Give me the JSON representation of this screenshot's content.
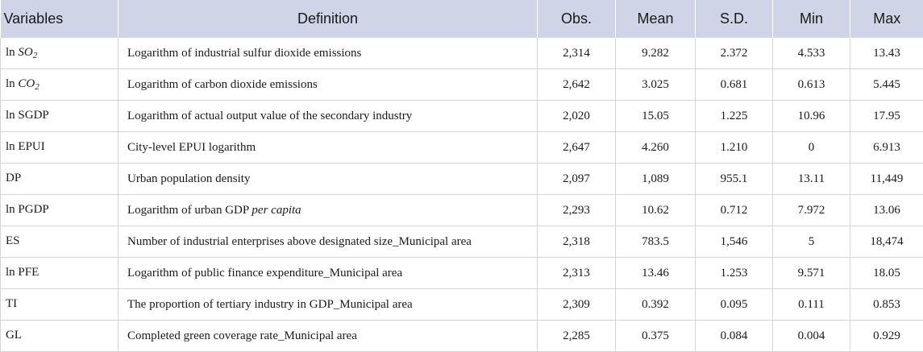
{
  "header": {
    "variables": "Variables",
    "definition": "Definition",
    "obs": "Obs.",
    "mean": "Mean",
    "sd": "S.D.",
    "min": "Min",
    "max": "Max"
  },
  "rows": [
    {
      "var_prefix": "ln ",
      "var_main": "SO",
      "var_sub": "2",
      "def_pre": "Logarithm of industrial sulfur dioxide emissions",
      "def_it": "",
      "obs": "2,314",
      "mean": "9.282",
      "sd": "2.372",
      "min": "4.533",
      "max": "13.43"
    },
    {
      "var_prefix": "ln ",
      "var_main": "CO",
      "var_sub": "2",
      "def_pre": "Logarithm of carbon dioxide emissions",
      "def_it": "",
      "obs": "2,642",
      "mean": "3.025",
      "sd": "0.681",
      "min": "0.613",
      "max": "5.445"
    },
    {
      "var_prefix": "ln SGDP",
      "var_main": "",
      "var_sub": "",
      "def_pre": "Logarithm of actual output value of the secondary industry",
      "def_it": "",
      "obs": "2,020",
      "mean": "15.05",
      "sd": "1.225",
      "min": "10.96",
      "max": "17.95"
    },
    {
      "var_prefix": "ln EPUI",
      "var_main": "",
      "var_sub": "",
      "def_pre": "City-level EPUI logarithm",
      "def_it": "",
      "obs": "2,647",
      "mean": "4.260",
      "sd": "1.210",
      "min": "0",
      "max": "6.913"
    },
    {
      "var_prefix": "DP",
      "var_main": "",
      "var_sub": "",
      "def_pre": "Urban population density",
      "def_it": "",
      "obs": "2,097",
      "mean": "1,089",
      "sd": "955.1",
      "min": "13.11",
      "max": "11,449"
    },
    {
      "var_prefix": "ln PGDP",
      "var_main": "",
      "var_sub": "",
      "def_pre": "Logarithm of urban GDP ",
      "def_it": "per capita",
      "obs": "2,293",
      "mean": "10.62",
      "sd": "0.712",
      "min": "7.972",
      "max": "13.06"
    },
    {
      "var_prefix": "ES",
      "var_main": "",
      "var_sub": "",
      "def_pre": "Number of industrial enterprises above designated size_Municipal area",
      "def_it": "",
      "obs": "2,318",
      "mean": "783.5",
      "sd": "1,546",
      "min": "5",
      "max": "18,474"
    },
    {
      "var_prefix": "ln PFE",
      "var_main": "",
      "var_sub": "",
      "def_pre": "Logarithm of public finance expenditure_Municipal area",
      "def_it": "",
      "obs": "2,313",
      "mean": "13.46",
      "sd": "1.253",
      "min": "9.571",
      "max": "18.05"
    },
    {
      "var_prefix": "TI",
      "var_main": "",
      "var_sub": "",
      "def_pre": "The proportion of tertiary industry in GDP_Municipal area",
      "def_it": "",
      "obs": "2,309",
      "mean": "0.392",
      "sd": "0.095",
      "min": "0.111",
      "max": "0.853"
    },
    {
      "var_prefix": "GL",
      "var_main": "",
      "var_sub": "",
      "def_pre": "Completed green coverage rate_Municipal area",
      "def_it": "",
      "obs": "2,285",
      "mean": "0.375",
      "sd": "0.084",
      "min": "0.004",
      "max": "0.929"
    }
  ]
}
